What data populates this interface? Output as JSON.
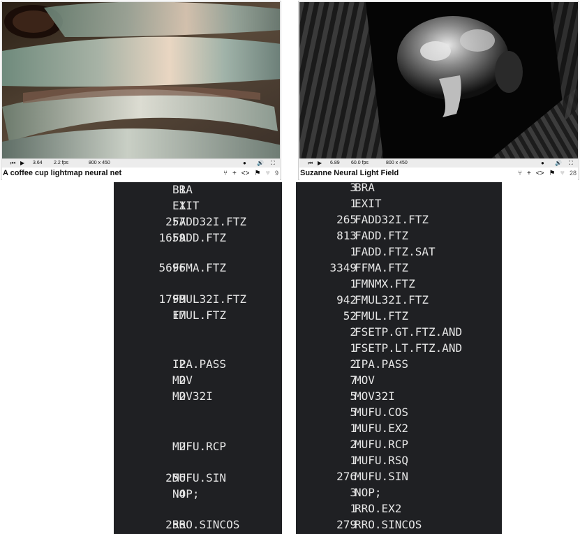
{
  "left_panel": {
    "title": "A coffee cup lightmap neural net",
    "time": "3.64",
    "fps": "2.2 fps",
    "resolution": "800 x 450",
    "likes": "9"
  },
  "right_panel": {
    "title": "Suzanne Neural Light Field",
    "time": "6.89",
    "fps": "60.0 fps",
    "resolution": "800 x 450",
    "likes": "28"
  },
  "icons": {
    "rewind": "⏮",
    "play": "▶",
    "rec": "●",
    "volume": "🔊",
    "fullscreen": "⛶",
    "fork": "⑂",
    "plus": "+",
    "code": "<>",
    "flag": "⚑",
    "heart": "♥"
  },
  "left_listing": [
    {
      "count": "1",
      "op": "BRA"
    },
    {
      "count": "1",
      "op": "EXIT"
    },
    {
      "count": "257",
      "op": "FADD32I.FTZ"
    },
    {
      "count": "1659",
      "op": "FADD.FTZ"
    },
    {
      "count": "5696",
      "op": "FFMA.FTZ"
    },
    {
      "count": "1799",
      "op": "FMUL32I.FTZ"
    },
    {
      "count": "17",
      "op": "FMUL.FTZ"
    },
    {
      "count": "2",
      "op": "IPA.PASS"
    },
    {
      "count": "2",
      "op": "MOV"
    },
    {
      "count": "2",
      "op": "MOV32I"
    },
    {
      "count": "2",
      "op": "MUFU.RCP"
    },
    {
      "count": "256",
      "op": "MUFU.SIN"
    },
    {
      "count": "4",
      "op": "NOP;"
    },
    {
      "count": "256",
      "op": "RRO.SINCOS"
    }
  ],
  "right_listing": [
    {
      "count": "3",
      "op": "BRA"
    },
    {
      "count": "1",
      "op": "EXIT"
    },
    {
      "count": "265",
      "op": "FADD32I.FTZ"
    },
    {
      "count": "813",
      "op": "FADD.FTZ"
    },
    {
      "count": "1",
      "op": "FADD.FTZ.SAT"
    },
    {
      "count": "3349",
      "op": "FFMA.FTZ"
    },
    {
      "count": "1",
      "op": "FMNMX.FTZ"
    },
    {
      "count": "942",
      "op": "FMUL32I.FTZ"
    },
    {
      "count": "52",
      "op": "FMUL.FTZ"
    },
    {
      "count": "2",
      "op": "FSETP.GT.FTZ.AND"
    },
    {
      "count": "1",
      "op": "FSETP.LT.FTZ.AND"
    },
    {
      "count": "2",
      "op": "IPA.PASS"
    },
    {
      "count": "7",
      "op": "MOV"
    },
    {
      "count": "5",
      "op": "MOV32I"
    },
    {
      "count": "5",
      "op": "MUFU.COS"
    },
    {
      "count": "1",
      "op": "MUFU.EX2"
    },
    {
      "count": "2",
      "op": "MUFU.RCP"
    },
    {
      "count": "1",
      "op": "MUFU.RSQ"
    },
    {
      "count": "276",
      "op": "MUFU.SIN"
    },
    {
      "count": "3",
      "op": "NOP;"
    },
    {
      "count": "1",
      "op": "RRO.EX2"
    },
    {
      "count": "279",
      "op": "RRO.SINCOS"
    }
  ]
}
